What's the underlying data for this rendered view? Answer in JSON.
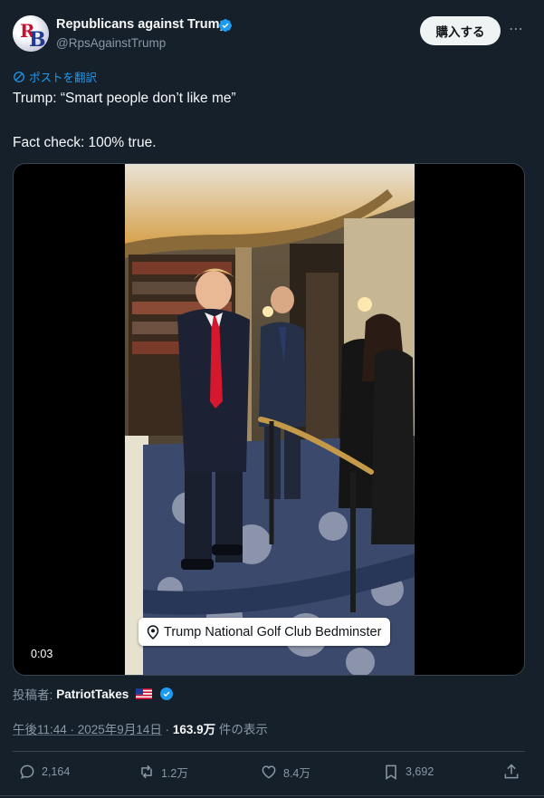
{
  "author": {
    "name": "Republicans against Trump",
    "handle": "@RpsAgainstTrump",
    "avatar_letters": [
      "R",
      "B"
    ]
  },
  "header": {
    "buy_button": "購入する",
    "more_icon": "more-dots-icon"
  },
  "translate_label": "ポストを翻訳",
  "tweet": {
    "line1": "Trump: “Smart people don’t like me”",
    "line2": "Fact check: 100% true."
  },
  "media": {
    "location": "Trump National Golf Club Bedminster",
    "timecode": "0:03"
  },
  "poster": {
    "prefix": "投稿者:",
    "name": "PatriotTakes",
    "flag_icon": "us-flag-icon"
  },
  "meta": {
    "time": "午後11:44 · 2025年9月14日",
    "separator": " · ",
    "views": "163.9万",
    "views_suffix": " 件の表示"
  },
  "actions": {
    "replies": "2,164",
    "reposts": "1.2万",
    "likes": "8.4万",
    "bookmarks": "3,692"
  },
  "colors": {
    "background": "#15202b",
    "accent": "#1d9bf0",
    "muted": "#8b98a5"
  }
}
